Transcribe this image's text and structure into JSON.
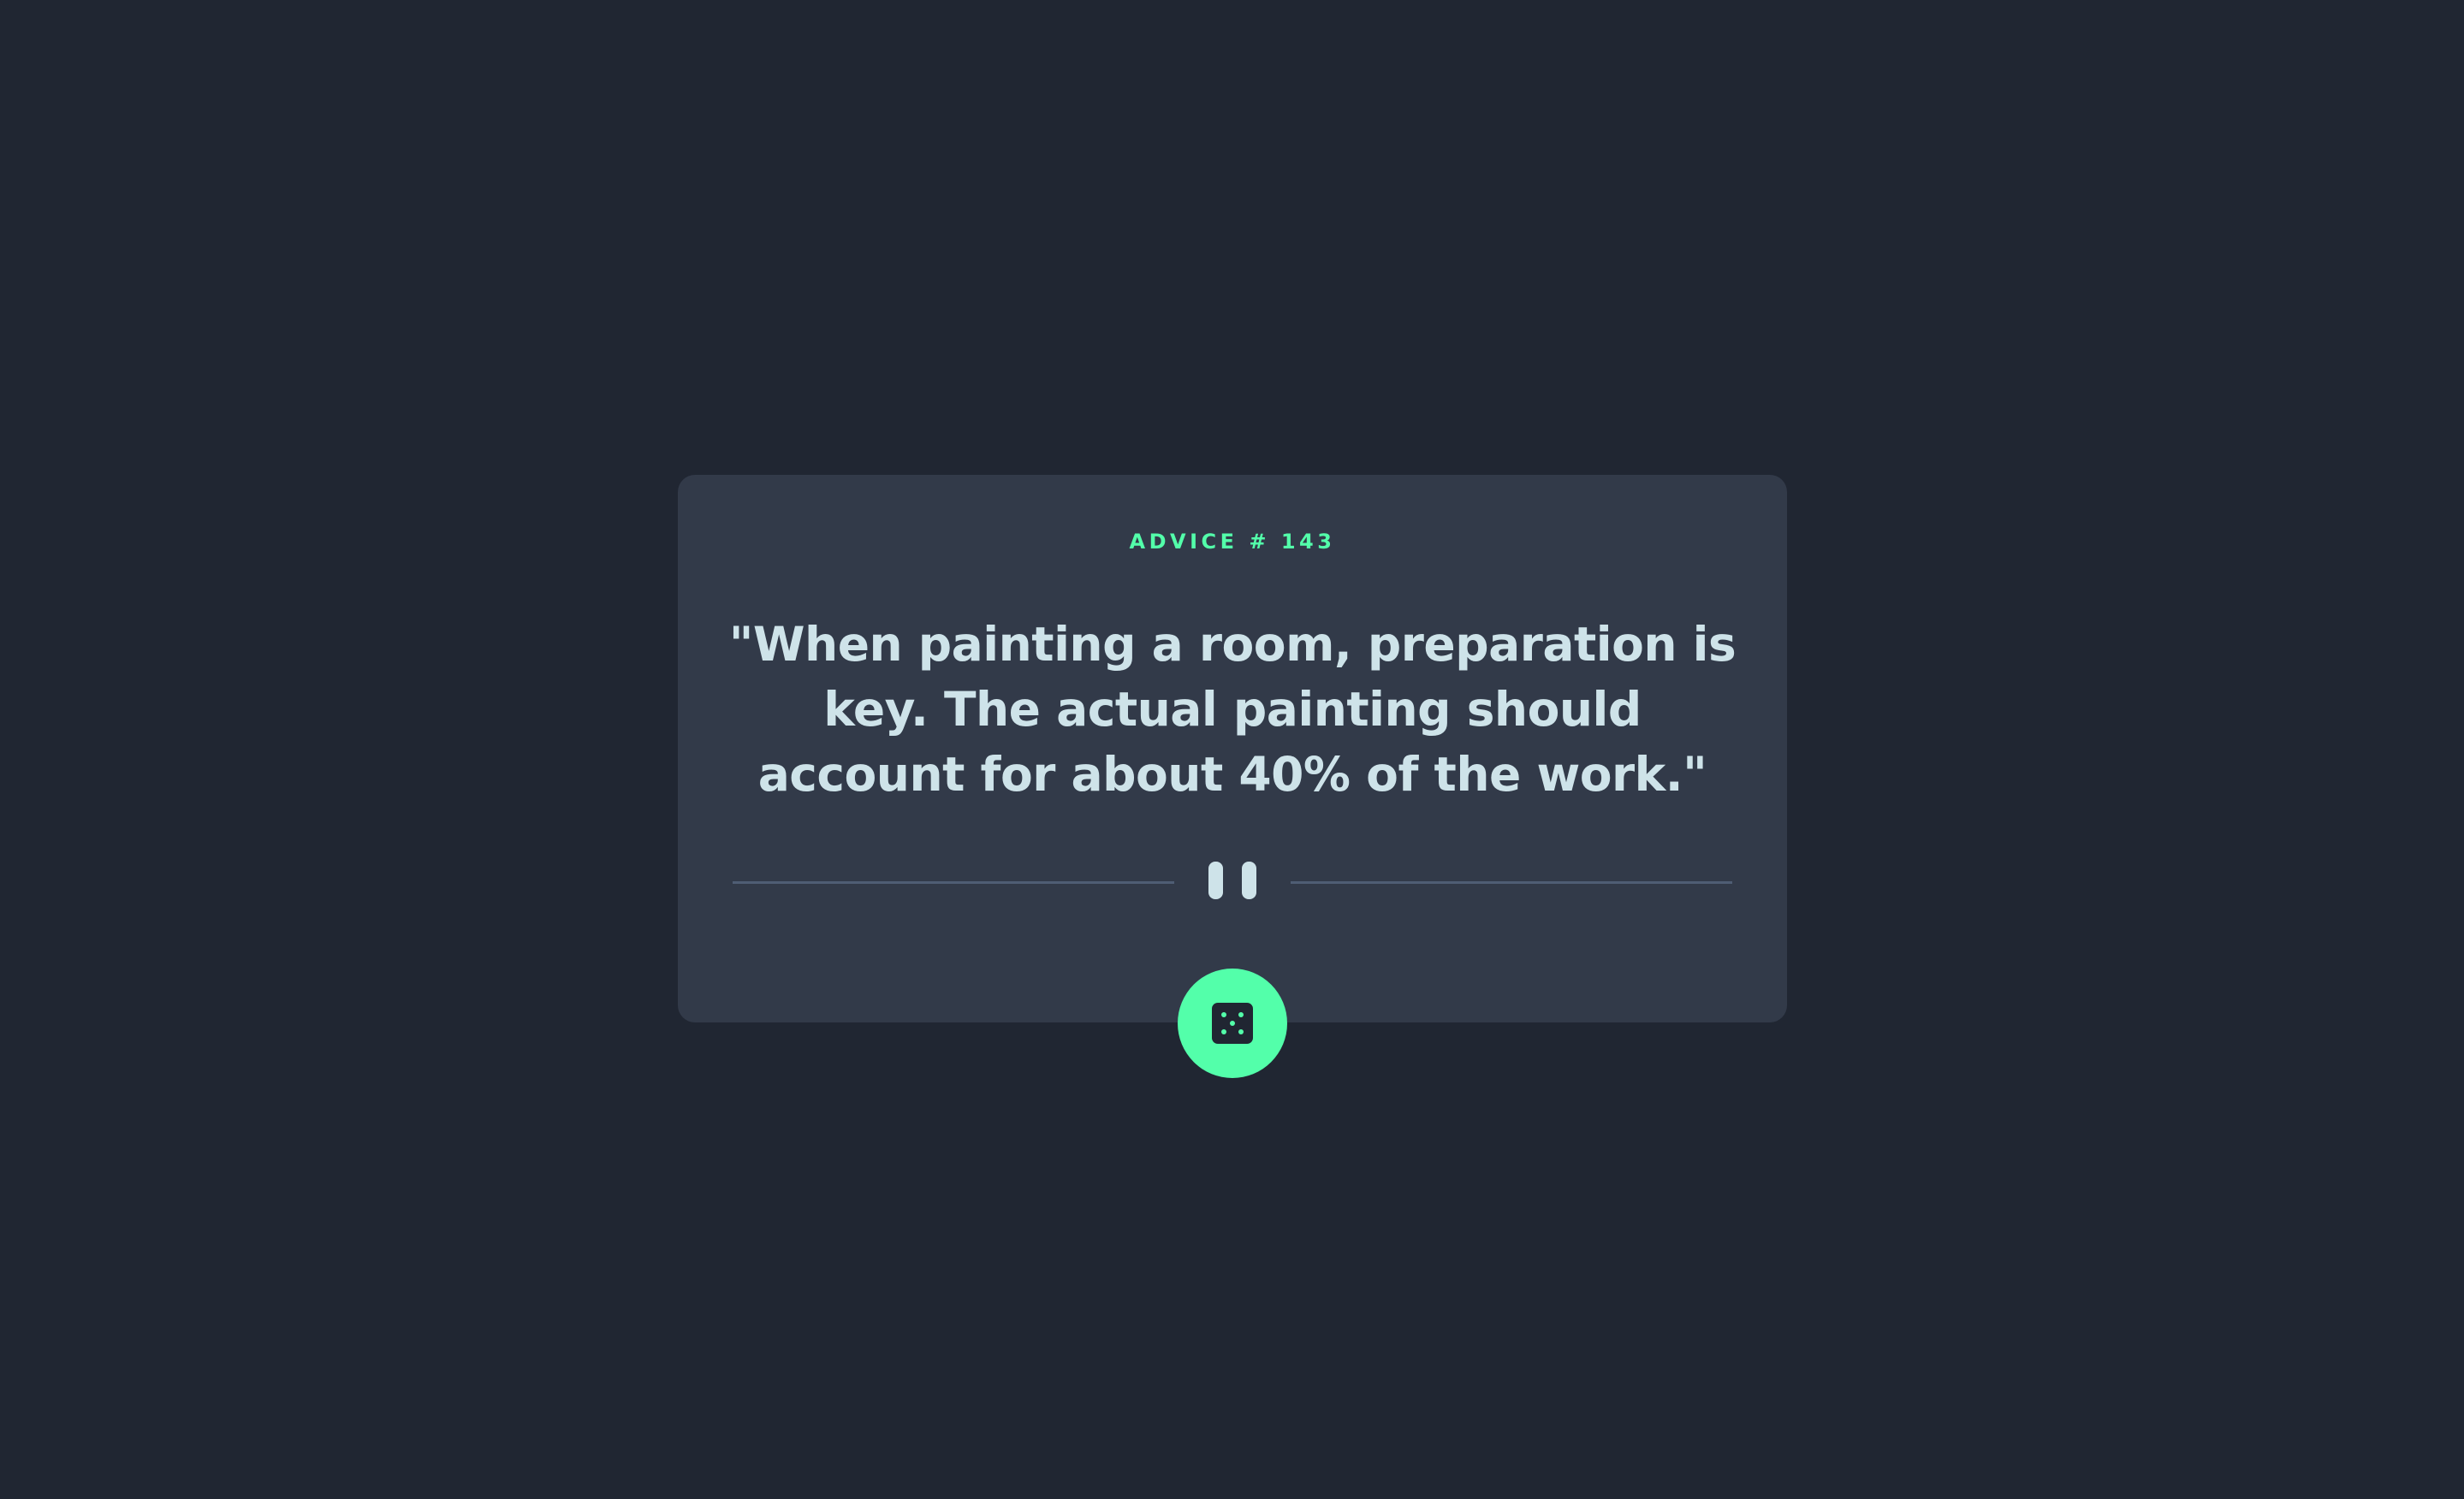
{
  "card": {
    "advice_label": "ADVICE # 143",
    "advice_text": "\"When painting a room, preparation is key. The actual painting should account for about 40% of the work.\""
  },
  "icons": {
    "divider": "pause-icon",
    "button": "dice-icon"
  },
  "colors": {
    "background": "#202632",
    "card": "#323a49",
    "accent": "#53ffaa",
    "text": "#cee3e9",
    "divider": "#4f5d74"
  }
}
